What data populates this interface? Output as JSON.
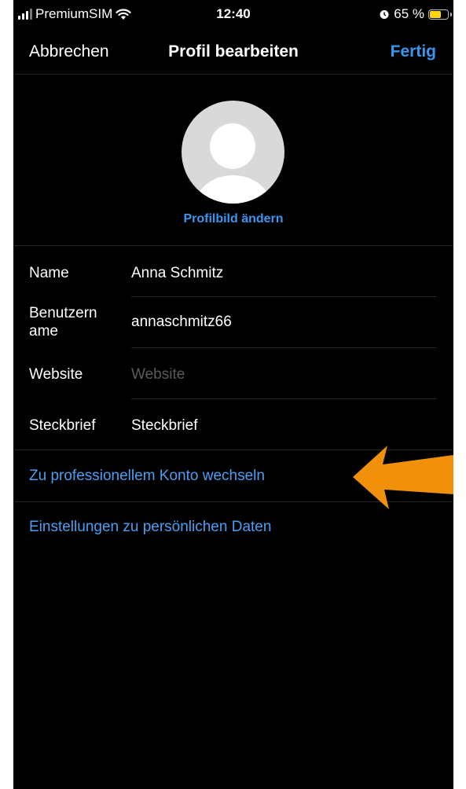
{
  "status_bar": {
    "carrier": "PremiumSIM",
    "time": "12:40",
    "battery_text": "65 %",
    "battery_level": 0.65,
    "icons": [
      "signal-icon",
      "wifi-icon",
      "alarm-icon",
      "battery-icon"
    ]
  },
  "nav": {
    "cancel_label": "Abbrechen",
    "title": "Profil bearbeiten",
    "done_label": "Fertig"
  },
  "profile": {
    "change_photo_label": "Profilbild ändern"
  },
  "fields": [
    {
      "label": "Name",
      "value": "Anna Schmitz",
      "placeholder": ""
    },
    {
      "label": "Benutzern ame",
      "value": "annaschmitz66",
      "placeholder": ""
    },
    {
      "label": "Website",
      "value": "",
      "placeholder": "Website"
    },
    {
      "label": "Steckbrief",
      "value": "",
      "placeholder": "Steckbrief"
    }
  ],
  "links": {
    "professional": "Zu professionellem Konto wechseln",
    "personal_data": "Einstellungen zu persönlichen Daten"
  },
  "colors": {
    "background": "#000000",
    "accent_blue": "#3897f0",
    "annotation_arrow": "#f0900b"
  }
}
